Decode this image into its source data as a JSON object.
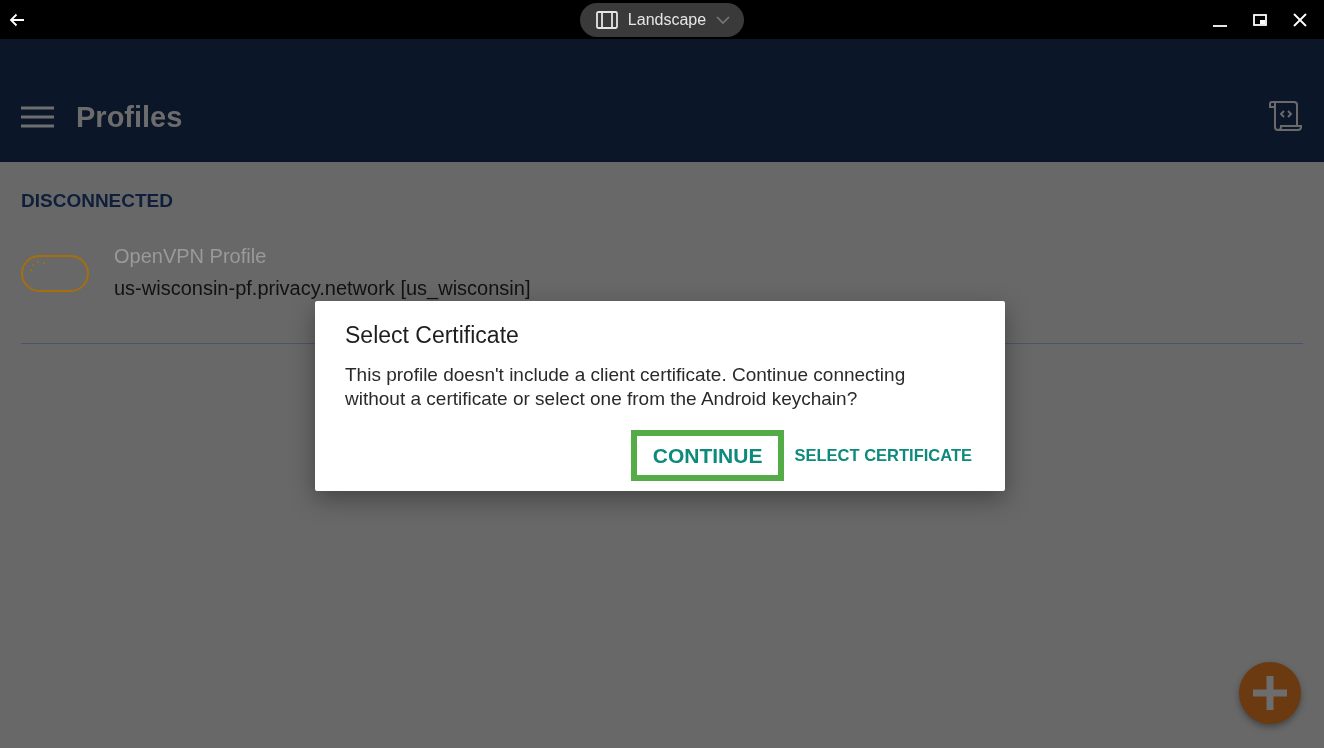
{
  "title_bar": {
    "orientation_menu": "Landscape"
  },
  "app_bar": {
    "title": "Profiles"
  },
  "section_header": "DISCONNECTED",
  "profiles": [
    {
      "type": "OpenVPN Profile",
      "name": "us-wisconsin-pf.privacy.network [us_wisconsin]",
      "connecting": true
    }
  ],
  "dialog": {
    "title": "Select Certificate",
    "message": "This profile doesn't include a client certificate. Continue connecting without a certificate or select one from the Android keychain?",
    "buttons": [
      {
        "label": "CONTINUE",
        "focused": true
      },
      {
        "label": "SELECT CERTIFICATE",
        "focused": false
      }
    ]
  }
}
